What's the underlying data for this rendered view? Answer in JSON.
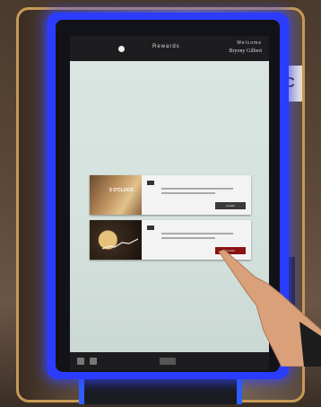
{
  "wall": {
    "sign_letter": "C"
  },
  "kiosk": {
    "header": {
      "title": "Rewards",
      "welcome_label": "Welcome",
      "user_name": "Bryony Gilbert"
    },
    "cards": [
      {
        "thumb_text": "5 O'CLOCK",
        "button_label": "CLAIM"
      },
      {
        "thumb_text": "",
        "button_label": "CLAIM"
      }
    ]
  },
  "colors": {
    "frame": "#c79a55",
    "kiosk_glow": "#2b3cff",
    "claim_active": "#8a1212"
  }
}
